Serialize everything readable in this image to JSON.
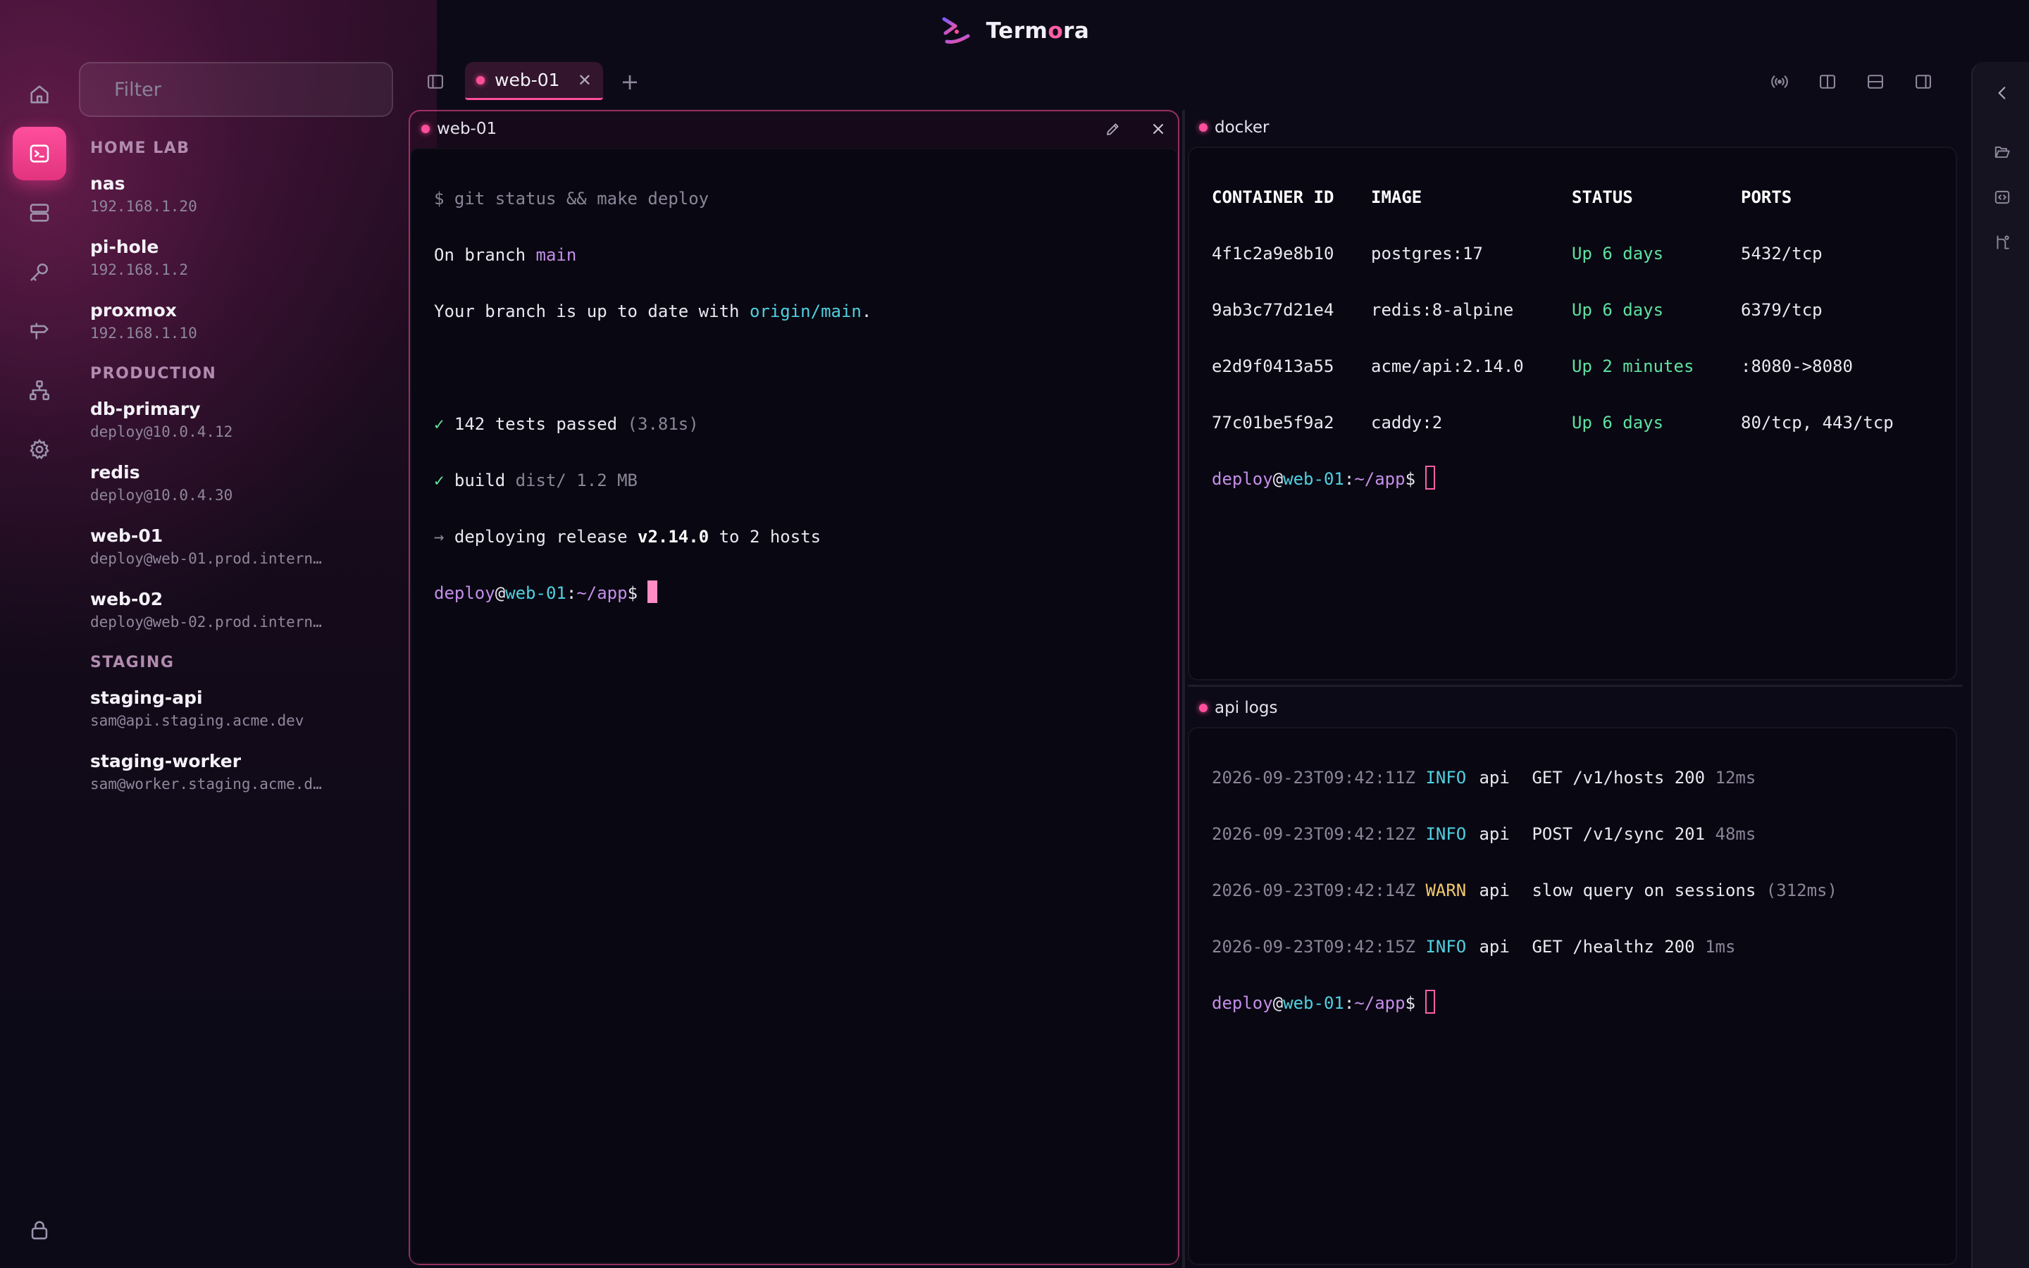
{
  "app": {
    "name_prefix": "Term",
    "name_accent": "o",
    "name_suffix": "ra"
  },
  "sidebar": {
    "filter_placeholder": "Filter",
    "groups": [
      {
        "label": "HOME LAB",
        "hosts": [
          {
            "name": "nas",
            "address": "192.168.1.20"
          },
          {
            "name": "pi-hole",
            "address": "192.168.1.2"
          },
          {
            "name": "proxmox",
            "address": "192.168.1.10"
          }
        ]
      },
      {
        "label": "PRODUCTION",
        "hosts": [
          {
            "name": "db-primary",
            "address": "deploy@10.0.4.12"
          },
          {
            "name": "redis",
            "address": "deploy@10.0.4.30"
          },
          {
            "name": "web-01",
            "address": "deploy@web-01.prod.intern…"
          },
          {
            "name": "web-02",
            "address": "deploy@web-02.prod.intern…"
          }
        ]
      },
      {
        "label": "STAGING",
        "hosts": [
          {
            "name": "staging-api",
            "address": "sam@api.staging.acme.dev"
          },
          {
            "name": "staging-worker",
            "address": "sam@worker.staging.acme.d…"
          }
        ]
      }
    ]
  },
  "tabs": [
    {
      "label": "web-01",
      "close": "✕"
    }
  ],
  "tab_add": "+",
  "panes": {
    "web": {
      "title": "web-01",
      "lines": {
        "cmd": "$ git status && make deploy",
        "branch_prefix": "On branch ",
        "branch": "main",
        "uptodate_prefix": "Your branch is up to date with ",
        "uptodate_ref": "origin/main",
        "uptodate_suffix": ".",
        "tests_check": "✓",
        "tests_text": " 142 tests passed ",
        "tests_time": "(3.81s)",
        "build_check": "✓",
        "build_text": " build ",
        "build_detail": "dist/ 1.2 MB",
        "deploy_arrow": "→",
        "deploy_text": " deploying release ",
        "deploy_version": "v2.14.0",
        "deploy_suffix": " to 2 hosts"
      }
    },
    "docker": {
      "title": "docker",
      "headers": [
        "CONTAINER ID",
        "IMAGE",
        "STATUS",
        "PORTS"
      ],
      "rows": [
        [
          "4f1c2a9e8b10",
          "postgres:17",
          "Up 6 days",
          "5432/tcp"
        ],
        [
          "9ab3c77d21e4",
          "redis:8-alpine",
          "Up 6 days",
          "6379/tcp"
        ],
        [
          "e2d9f0413a55",
          "acme/api:2.14.0",
          "Up 2 minutes",
          ":8080->8080"
        ],
        [
          "77c01be5f9a2",
          "caddy:2",
          "Up 6 days",
          "80/tcp, 443/tcp"
        ]
      ]
    },
    "logs": {
      "title": "api logs",
      "rows": [
        {
          "ts": "2026-09-23T09:42:11Z",
          "level": "INFO",
          "svc": "api",
          "msg": "GET /v1/hosts 200",
          "dur": "12ms"
        },
        {
          "ts": "2026-09-23T09:42:12Z",
          "level": "INFO",
          "svc": "api",
          "msg": "POST /v1/sync 201",
          "dur": "48ms"
        },
        {
          "ts": "2026-09-23T09:42:14Z",
          "level": "WARN",
          "svc": "api",
          "msg": "slow query on sessions",
          "dur": "(312ms)"
        },
        {
          "ts": "2026-09-23T09:42:15Z",
          "level": "INFO",
          "svc": "api",
          "msg": "GET /healthz 200",
          "dur": "1ms"
        }
      ]
    }
  },
  "prompt": {
    "user": "deploy",
    "at": "@",
    "host": "web-01",
    "colon": ":",
    "path": "~/app",
    "dollar": "$ "
  },
  "colors": {
    "accent": "#ff4f9c",
    "info": "#4fd1e0",
    "warn": "#f2c96b",
    "ok": "#5fe1a0",
    "prompt_user": "#c48ee8"
  }
}
